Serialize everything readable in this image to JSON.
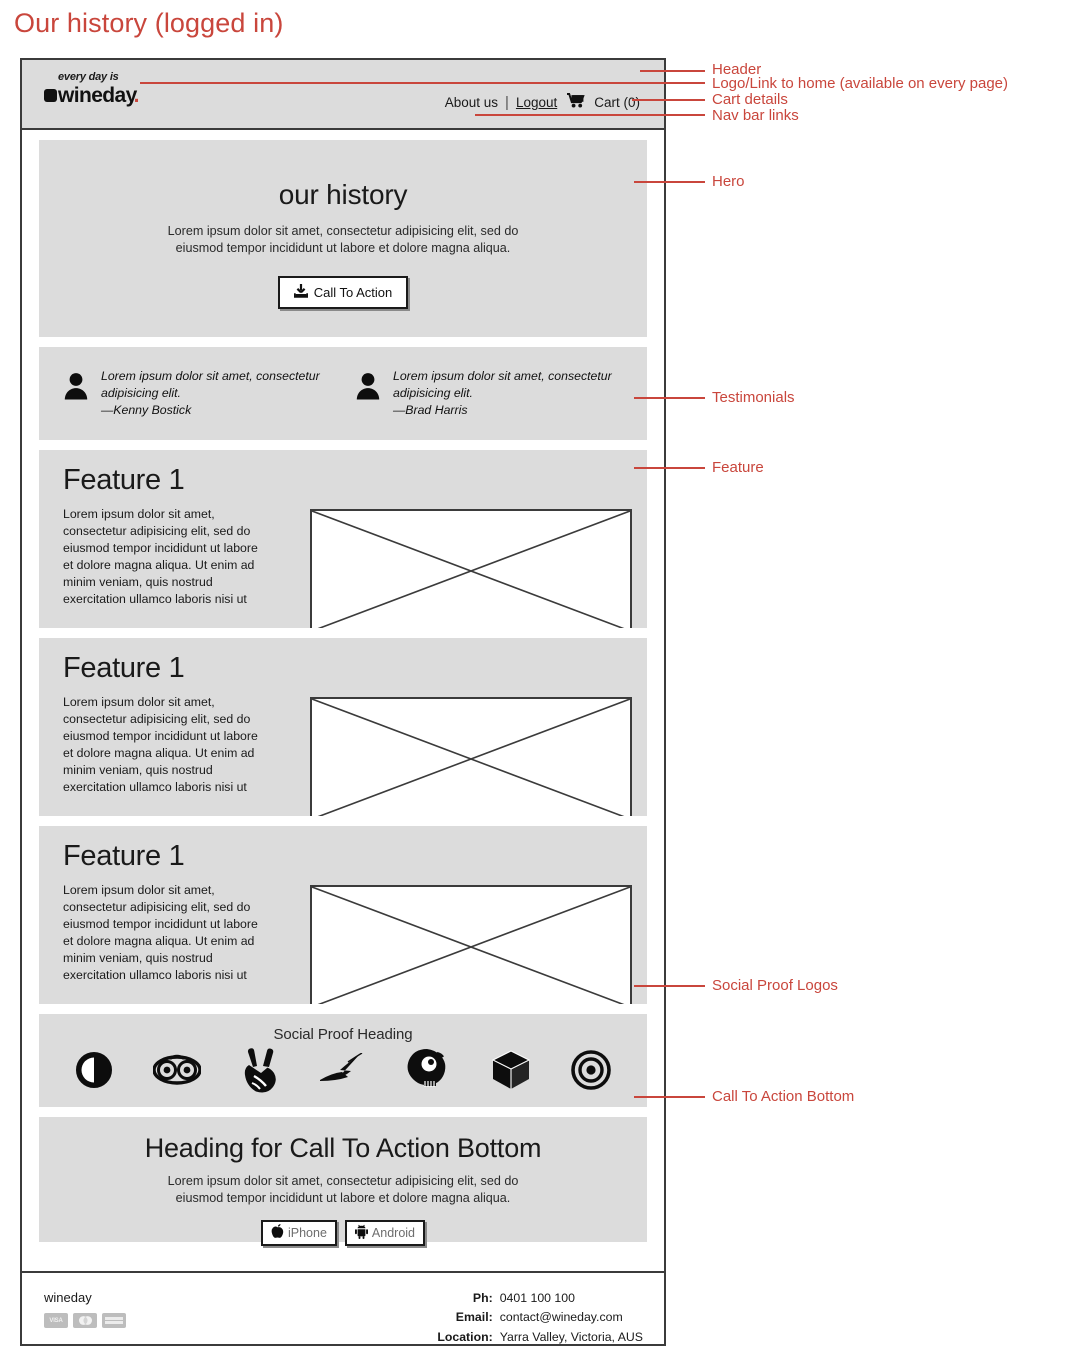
{
  "page": {
    "title": "Our history (logged in)",
    "accent_color": "#c9463c"
  },
  "header": {
    "logo": {
      "tagline": "every day is",
      "name": "wineday",
      "mark_icon": "wine-mark-icon"
    },
    "nav": {
      "about": "About us",
      "separator": "|",
      "logout": "Logout",
      "cart_icon": "shopping-cart-icon",
      "cart": "Cart (0)"
    }
  },
  "hero": {
    "heading": "our history",
    "body": "Lorem ipsum dolor sit amet, consectetur adipisicing elit, sed do eiusmod tempor incididunt ut labore et dolore magna aliqua.",
    "cta_label": "Call To Action",
    "cta_icon": "download-icon"
  },
  "testimonials": [
    {
      "avatar_icon": "user-avatar-icon",
      "quote": "Lorem ipsum dolor sit amet, consectetur adipisicing elit.",
      "author": "—Kenny Bostick"
    },
    {
      "avatar_icon": "user-avatar-icon",
      "quote": "Lorem ipsum dolor sit amet, consectetur adipisicing elit.",
      "author": "—Brad Harris"
    }
  ],
  "features": [
    {
      "heading": "Feature 1",
      "body": "Lorem ipsum dolor sit amet, consectetur adipisicing elit, sed do eiusmod tempor incididunt ut labore et dolore magna aliqua. Ut enim ad minim veniam, quis nostrud exercitation ullamco laboris nisi ut aliquip ex ea commodo consequat.",
      "image_placeholder": "image-placeholder"
    },
    {
      "heading": "Feature 1",
      "body": "Lorem ipsum dolor sit amet, consectetur adipisicing elit, sed do eiusmod tempor incididunt ut labore et dolore magna aliqua. Ut enim ad minim veniam, quis nostrud exercitation ullamco laboris nisi ut aliquip ex ea commodo consequat.",
      "image_placeholder": "image-placeholder"
    },
    {
      "heading": "Feature 1",
      "body": "Lorem ipsum dolor sit amet, consectetur adipisicing elit, sed do eiusmod tempor incididunt ut labore et dolore magna aliqua. Ut enim ad minim veniam, quis nostrud exercitation ullamco laboris nisi ut aliquip ex ea commodo consequat.",
      "image_placeholder": "image-placeholder"
    }
  ],
  "social_proof": {
    "heading": "Social Proof Heading",
    "logos": [
      "adversal-contrast-icon",
      "tripadvisor-owl-icon",
      "peace-hand-icon",
      "quill-pen-icon",
      "twitter-bird-icon",
      "cube-3d-icon",
      "bullseye-target-icon"
    ]
  },
  "cta_bottom": {
    "heading": "Heading for Call To Action Bottom",
    "body": "Lorem ipsum dolor sit amet, consectetur adipisicing elit, sed do eiusmod tempor incididunt ut labore et dolore magna aliqua.",
    "buttons": [
      {
        "label": "iPhone",
        "icon": "apple-icon"
      },
      {
        "label": "Android",
        "icon": "android-icon"
      }
    ]
  },
  "footer": {
    "brand": "wineday",
    "cards": [
      {
        "label": "VISA",
        "icon": "visa-card-icon"
      },
      {
        "label": "",
        "icon": "mastercard-card-icon"
      },
      {
        "label": "AMERICAN EXPRESS",
        "icon": "amex-card-icon"
      }
    ],
    "contact": [
      {
        "key": "Ph:",
        "value": "0401 100 100"
      },
      {
        "key": "Email:",
        "value": "contact@wineday.com"
      },
      {
        "key": "Location:",
        "value": "Yarra Valley, Victoria, AUS"
      }
    ]
  },
  "annotations": [
    {
      "label": "Header"
    },
    {
      "label": "Logo/Link to home (available on every page)"
    },
    {
      "label": "Cart details"
    },
    {
      "label": "Nav bar links"
    },
    {
      "label": "Hero"
    },
    {
      "label": "Testimonials"
    },
    {
      "label": "Feature"
    },
    {
      "label": "Social Proof Logos"
    },
    {
      "label": "Call To Action Bottom"
    }
  ]
}
